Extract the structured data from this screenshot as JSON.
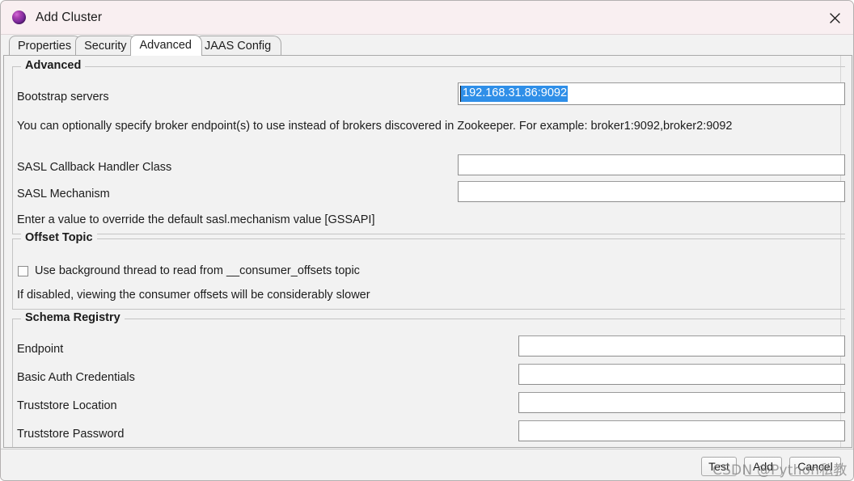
{
  "window": {
    "title": "Add Cluster",
    "icon": "cluster-sphere-icon",
    "close_icon": "close-icon"
  },
  "tabs": [
    {
      "label": "Properties",
      "active": false
    },
    {
      "label": "Security",
      "active": false
    },
    {
      "label": "Advanced",
      "active": true
    },
    {
      "label": "JAAS Config",
      "active": false
    }
  ],
  "groups": {
    "advanced": {
      "legend": "Advanced",
      "bootstrap_label": "Bootstrap servers",
      "bootstrap_value": "192.168.31.86:9092",
      "bootstrap_placeholder": "",
      "bootstrap_hint": "You can optionally specify broker endpoint(s) to use instead of brokers discovered in Zookeeper. For example: broker1:9092,broker2:9092",
      "sasl_callback_label": "SASL Callback Handler Class",
      "sasl_callback_value": "",
      "sasl_mechanism_label": "SASL Mechanism",
      "sasl_mechanism_value": "",
      "sasl_hint": "Enter a value to override the default sasl.mechanism value [GSSAPI]"
    },
    "offset_topic": {
      "legend": "Offset Topic",
      "checkbox_label": "Use background thread to read from __consumer_offsets topic",
      "checkbox_checked": false,
      "hint": "If disabled, viewing the consumer offsets will be considerably slower"
    },
    "schema_registry": {
      "legend": "Schema Registry",
      "endpoint_label": "Endpoint",
      "endpoint_value": "",
      "basic_auth_label": "Basic Auth Credentials",
      "basic_auth_value": "",
      "truststore_location_label": "Truststore Location",
      "truststore_location_value": "",
      "truststore_password_label": "Truststore Password",
      "truststore_password_value": ""
    }
  },
  "buttons": {
    "test": "Test",
    "add": "Add",
    "cancel": "Cancel"
  },
  "watermark": {
    "text": "CSDN @Python私教"
  },
  "colors": {
    "titlebar": "#f9eff1",
    "panel": "#f2f2f2",
    "selection": "#2f8fe8",
    "active_tab": "#ffffff",
    "field_border": "#8d8d8d"
  }
}
